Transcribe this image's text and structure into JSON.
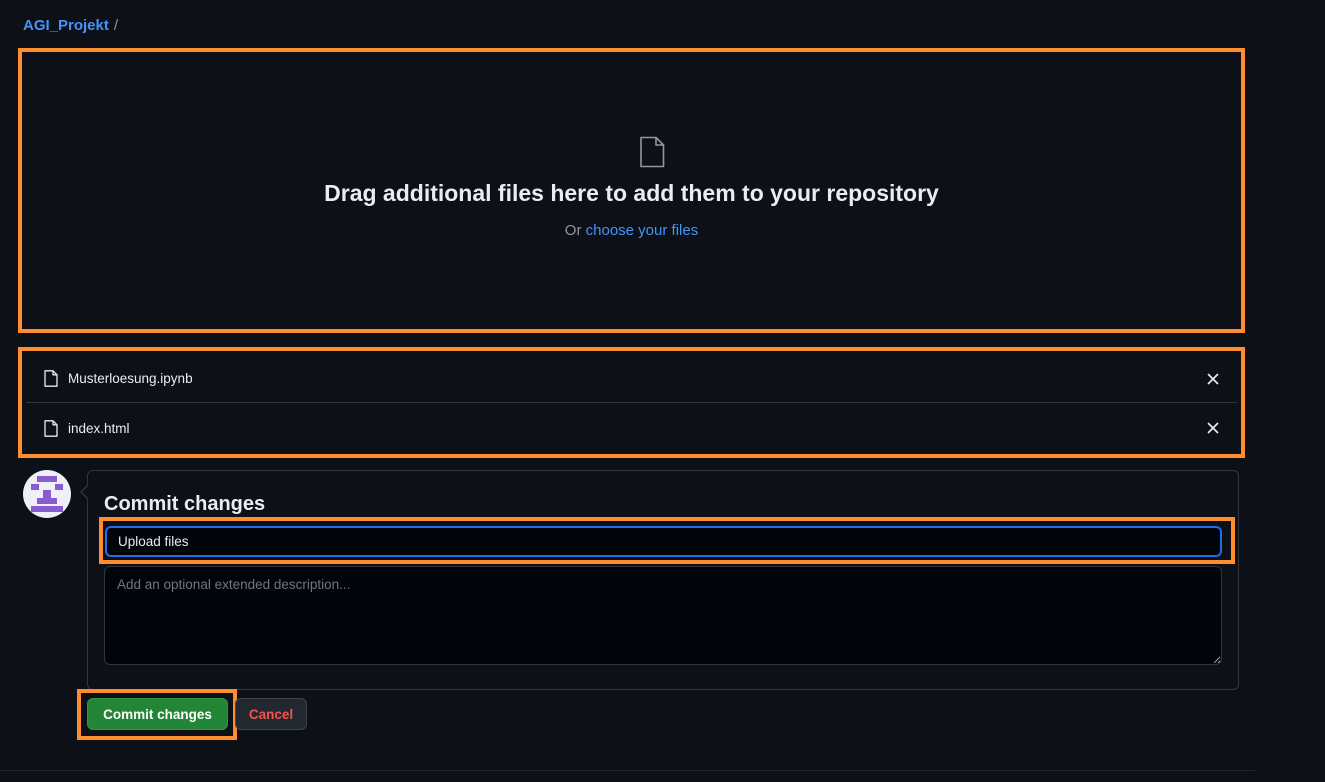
{
  "breadcrumb": {
    "repo": "AGI_Projekt",
    "separator": "/"
  },
  "dropzone": {
    "icon": "file-icon",
    "title": "Drag additional files here to add them to your repository",
    "subtitle_prefix": "Or",
    "choose_link": "choose your files"
  },
  "files": [
    {
      "name": "Musterloesung.ipynb",
      "icon": "file-icon",
      "remove_icon": "close-icon"
    },
    {
      "name": "index.html",
      "icon": "file-icon",
      "remove_icon": "close-icon"
    }
  ],
  "commit": {
    "title": "Commit changes",
    "summary_value": "Upload files",
    "description_placeholder": "Add an optional extended description..."
  },
  "buttons": {
    "commit": "Commit changes",
    "cancel": "Cancel"
  },
  "colors": {
    "highlight": "#ff8c2f",
    "link": "#4493f8",
    "commit_button": "#238636",
    "cancel_text": "#f85149",
    "background": "#0d1117"
  }
}
